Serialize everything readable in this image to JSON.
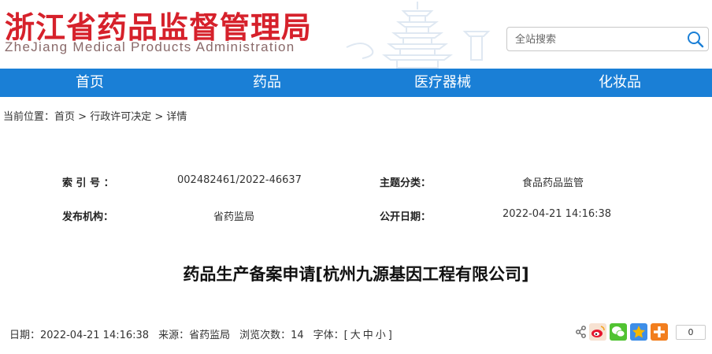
{
  "header": {
    "site_title_cn": "浙江省药品监督管理局",
    "site_title_en": "ZheJiang Medical Products Administration",
    "search_placeholder": "全站搜索",
    "search_icon": "search-icon"
  },
  "nav": {
    "items": [
      {
        "label": "首页"
      },
      {
        "label": "药品"
      },
      {
        "label": "医疗器械"
      },
      {
        "label": "化妆品"
      }
    ]
  },
  "breadcrumb": {
    "prefix": "当前位置：",
    "items": [
      "首页",
      "行政许可决定",
      "详情"
    ],
    "separator": ">"
  },
  "meta": {
    "index_label": "索 引 号 ：",
    "index_value": "002482461/2022-46637",
    "category_label": "主题分类：",
    "category_value": "食品药品监管",
    "publisher_label": "发布机构：",
    "publisher_value": "省药监局",
    "date_label": "公开日期：",
    "date_value": "2022-04-21 14:16:38"
  },
  "article": {
    "title": "药品生产备案申请[杭州九源基因工程有限公司]",
    "date_text": "日期：2022-04-21 14:16:38",
    "source_text": "来源：省药监局",
    "views_text": "浏览次数：14",
    "font_prefix": "字体：[",
    "font_large": "大",
    "font_medium": "中",
    "font_small": "小",
    "font_suffix": "]"
  },
  "share": {
    "icons": [
      "share-icon",
      "weibo-icon",
      "wechat-icon",
      "qzone-icon",
      "more-share-icon"
    ],
    "count": "0",
    "colors": {
      "weibo": "#e6162d",
      "wechat": "#51c332",
      "qzone": "#f5b700",
      "more": "#f27e1e"
    }
  },
  "colors": {
    "brand_red": "#d6212b",
    "nav_blue": "#1a7fd6"
  }
}
